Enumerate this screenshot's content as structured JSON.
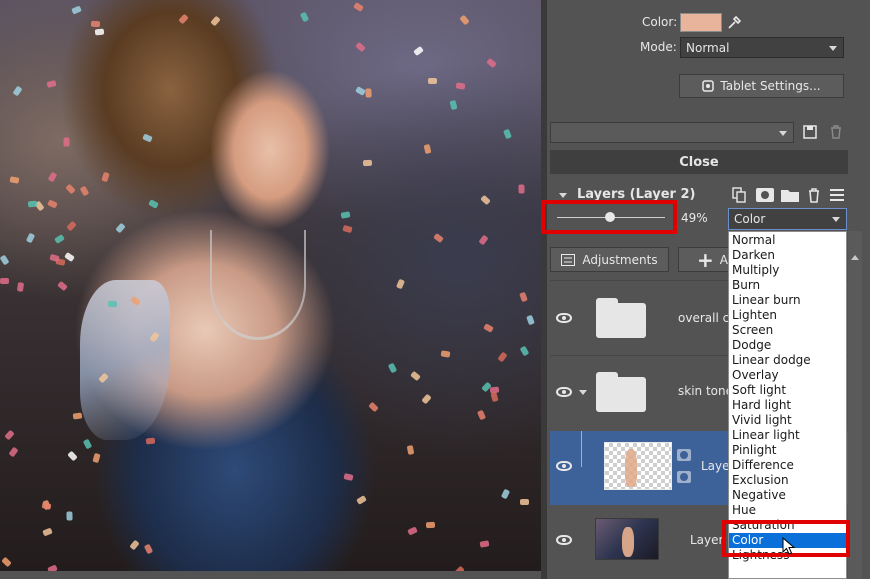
{
  "panel": {
    "color_label": "Color:",
    "color_value": "#e8b49c",
    "mode_label": "Mode:",
    "mode_value": "Normal",
    "tablet_button": "Tablet Settings...",
    "preset_value": "",
    "close_label": "Close"
  },
  "layers": {
    "title": "Layers (Layer 2)",
    "opacity_value": "49%",
    "opacity_fraction": 0.49,
    "blend_value": "Color",
    "adjustments_label": "Adjustments",
    "add_label": "Ad",
    "rows": [
      {
        "name": "overall co"
      },
      {
        "name": "skin tone"
      },
      {
        "name": "Layer"
      },
      {
        "name": "Layer"
      }
    ]
  },
  "blend_options": [
    "Normal",
    "Darken",
    "Multiply",
    "Burn",
    "Linear burn",
    "Lighten",
    "Screen",
    "Dodge",
    "Linear dodge",
    "Overlay",
    "Soft light",
    "Hard light",
    "Vivid light",
    "Linear light",
    "Pinlight",
    "Difference",
    "Exclusion",
    "Negative",
    "Hue",
    "Saturation",
    "Color",
    "Lightness"
  ],
  "blend_selected": "Color",
  "colors": {
    "panel_bg": "#535353",
    "selection_blue": "#3d6199",
    "list_highlight": "#0a6fd8",
    "annotation_red": "#e00000"
  }
}
